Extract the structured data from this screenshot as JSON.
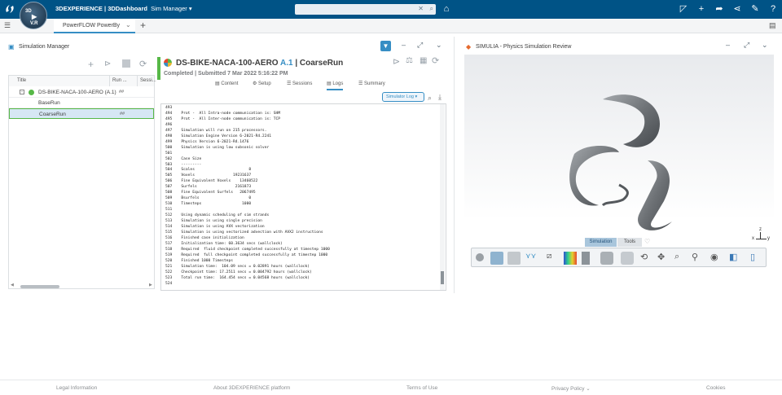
{
  "header": {
    "brand_bold": "3DEXPERIENCE | 3DDashboard",
    "app_name": "Sim Manager",
    "compass_label": "V.R",
    "compass_top": "3D"
  },
  "tabs": {
    "active_tab": "PowerFLOW PowerBy"
  },
  "sim_manager": {
    "title": "Simulation Manager",
    "columns": [
      "Title",
      "Run ...",
      "Sessi..."
    ],
    "rows": [
      {
        "name": "DS-BIKE-NACA-100-AERO (A.1)",
        "run": "##"
      },
      {
        "name": "BaseRun",
        "run": ""
      },
      {
        "name": "CoarseRun",
        "run": "##"
      }
    ]
  },
  "run_detail": {
    "title_prefix": "DS-BIKE-NACA-100-AERO ",
    "version": "A.1",
    "title_suffix": " | CoarseRun",
    "status": "Completed | Submitted 7 Mar 2022 5:16:22 PM",
    "subtabs": [
      "Content",
      "Setup",
      "Sessions",
      "Logs",
      "Summary"
    ],
    "log_selector": "Simulator Log",
    "log_lines": [
      "493",
      "494    Prot -  All Intra-node communication is: SHM",
      "495    Prot -  All Inter-node communication is: TCP",
      "496",
      "497    Simulation will run on 215 processors.",
      "498    Simulation Engine Version 6-2021-R4.2241",
      "499    Physics Version 6-2021-R4.1476",
      "500    Simulation is using low subsonic solver",
      "501",
      "502    Case Size",
      "503    ---------",
      "504    Scales                        8",
      "505    Voxels                 19231637",
      "506    Fine Equivalent Voxels    13460522",
      "507    Surfels                 2161873",
      "508    Fine Equivalent Surfels   2067495",
      "509    Bsurfels                      0",
      "510    Timesteps                  1000",
      "511",
      "512    Using dynamic scheduling of sim strands",
      "513    Simulation is using single precision",
      "514    Simulation is using AVX vectorization",
      "515    Simulation is using vectorized advection with AVX2 instructions",
      "516    Finished case initialization",
      "517    Initialization time: 60.3634 secs (wallclock)",
      "518    Required  fluid checkpoint completed successfully at timestep 1000",
      "519    Required  full checkpoint completed successfully at timestep 1000",
      "520    Finished 1000 Timesteps",
      "521    Simulation time:  104.09 secs = 0.02891 hours (wallclock)",
      "522    Checkpoint time: 17.2511 secs = 0.004792 hours (wallclock)",
      "523    Total run time:  164.454 secs = 0.04568 hours (wallclock)",
      "524"
    ]
  },
  "viewer": {
    "title": "SIMULIA - Physics Simulation Review",
    "tabs": [
      "Simulation",
      "Tools"
    ],
    "axes": [
      "z",
      "x",
      "y"
    ]
  },
  "footer": {
    "links": [
      "Legal Information",
      "About 3DEXPERIENCE platform",
      "Terms of Use",
      "Privacy Policy",
      "Cookies"
    ]
  },
  "colors": {
    "topbar": "#005386",
    "accent": "#368ec4",
    "status_green": "#57b847"
  }
}
